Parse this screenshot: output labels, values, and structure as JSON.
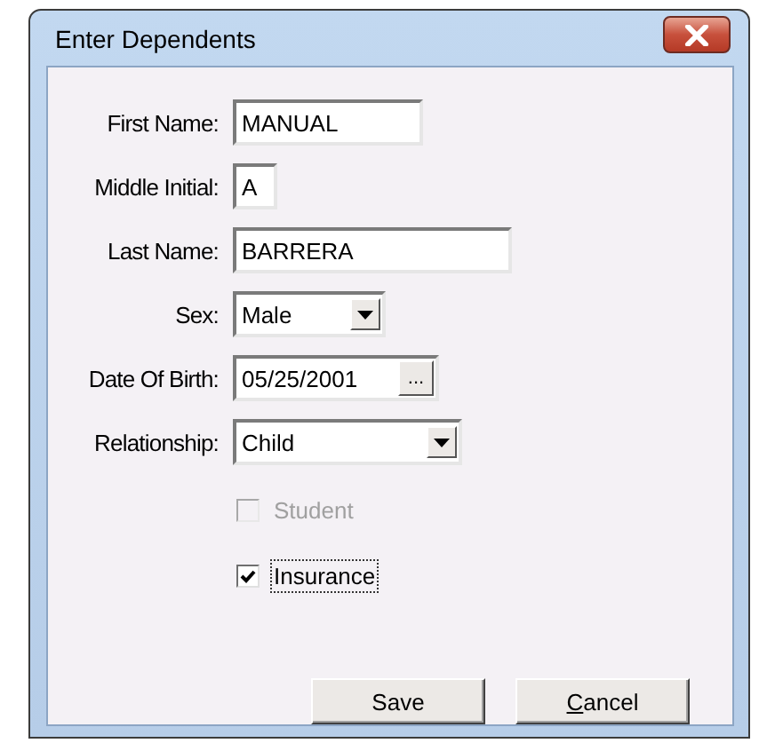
{
  "window": {
    "title": "Enter Dependents"
  },
  "fields": [
    {
      "kind": "text",
      "label": "First Name:",
      "value": "MANUAL"
    },
    {
      "kind": "text",
      "label": "Middle Initial:",
      "value": "A"
    },
    {
      "kind": "text",
      "label": "Last Name:",
      "value": "BARRERA"
    },
    {
      "kind": "dropdown",
      "label": "Sex:",
      "value": "Male"
    },
    {
      "kind": "date",
      "label": "Date Of Birth:",
      "value": "05/25/2001",
      "button": "..."
    },
    {
      "kind": "dropdown",
      "label": "Relationship:",
      "value": "Child"
    }
  ],
  "checkboxes": [
    {
      "label": "Student",
      "checked": false,
      "disabled": true,
      "focused": false
    },
    {
      "label": "Insurance",
      "checked": true,
      "disabled": false,
      "focused": true
    }
  ],
  "buttons": [
    {
      "label": "Save",
      "underline_first": false
    },
    {
      "label": "Cancel",
      "underline_first": true
    }
  ]
}
